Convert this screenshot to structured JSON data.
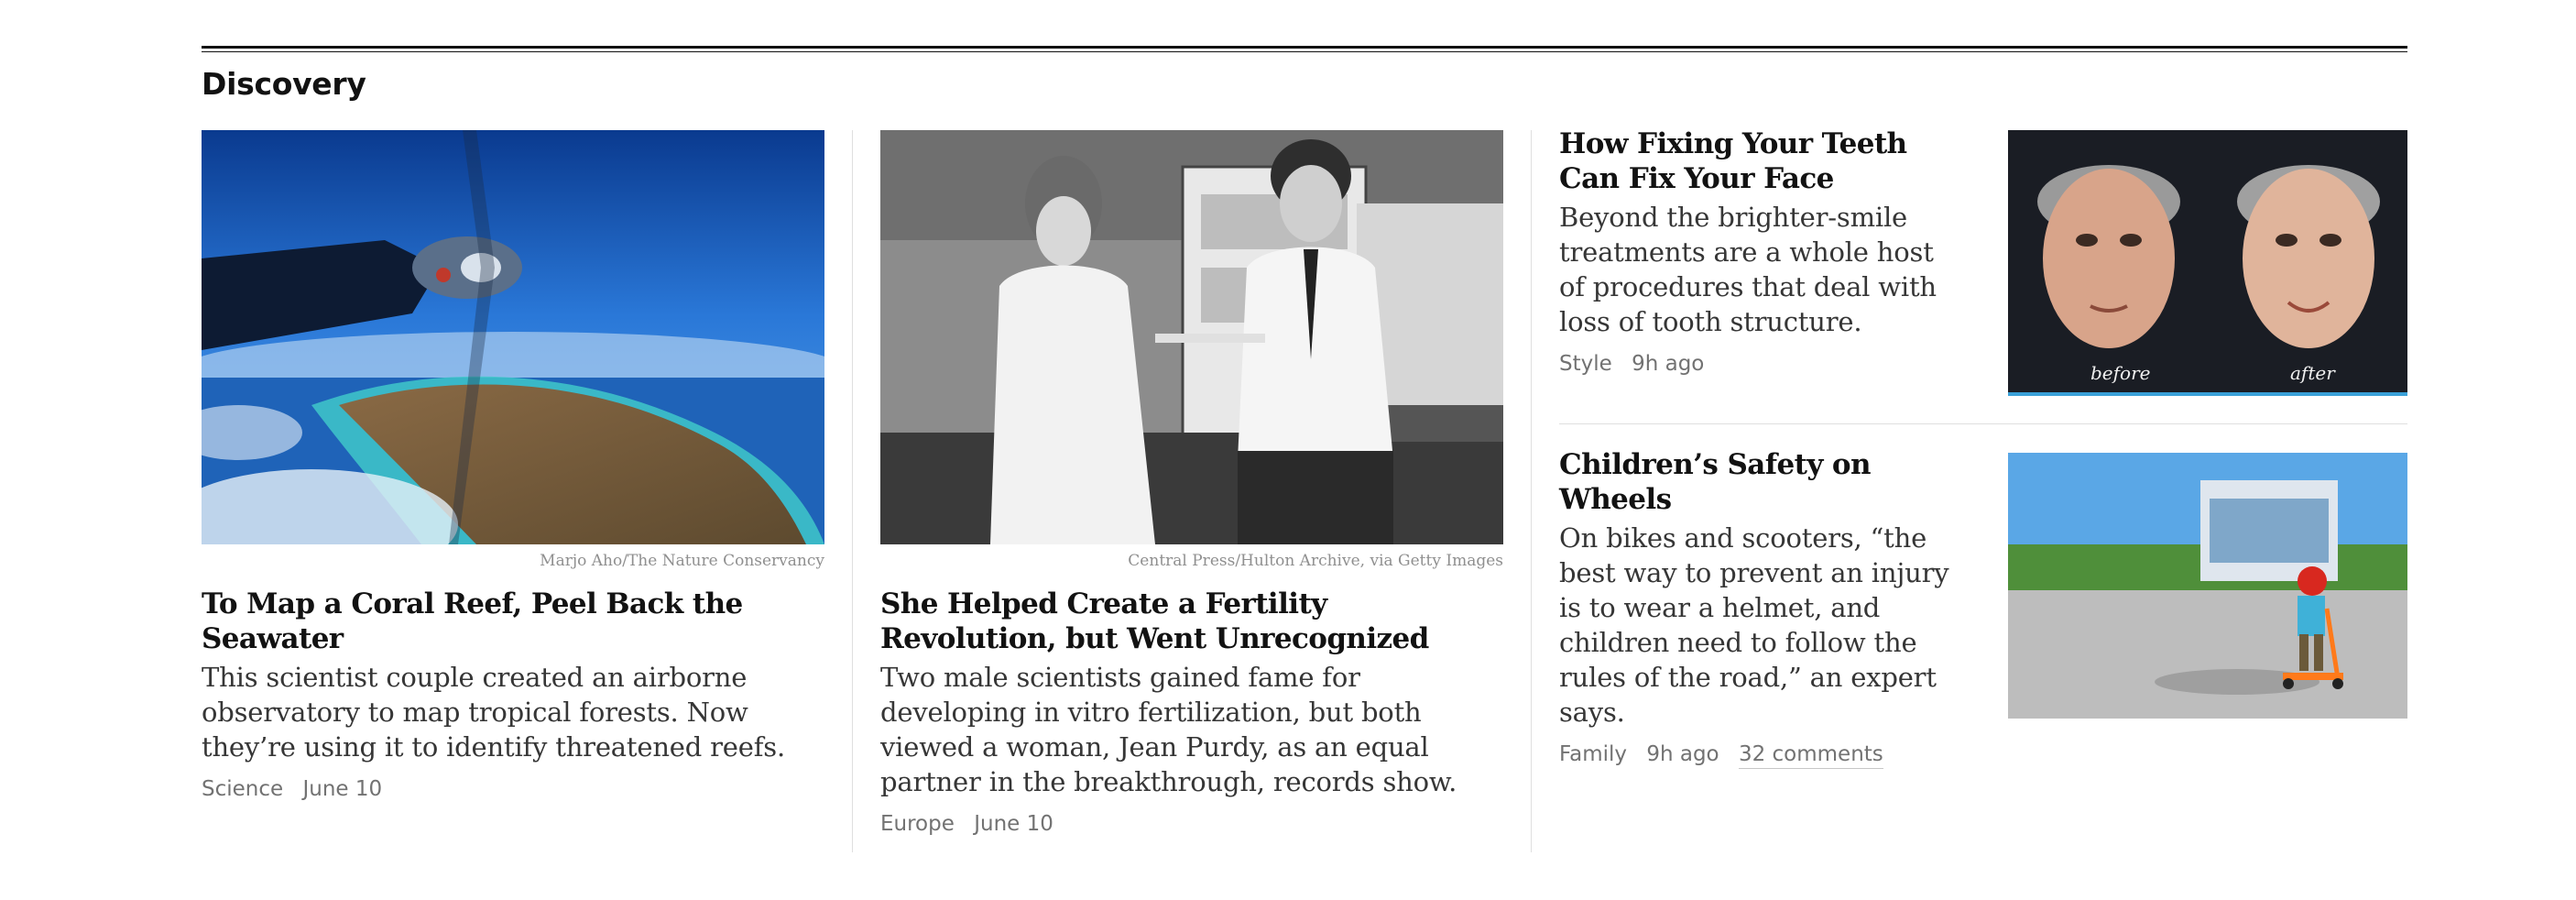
{
  "section": {
    "title": "Discovery"
  },
  "stories": [
    {
      "credit": "Marjo Aho/The Nature Conservancy",
      "headline": "To Map a Coral Reef, Peel Back the Seawater",
      "summary": "This scientist couple created an airborne observatory to map tropical forests. Now they’re using it to identify threatened reefs.",
      "section": "Science",
      "date": "June 10"
    },
    {
      "credit": "Central Press/Hulton Archive, via Getty Images",
      "headline": "She Helped Create a Fertility Revolution, but Went Unrecognized",
      "summary": "Two male scientists gained fame for developing in vitro fertilization, but both viewed a woman, Jean Purdy, as an equal partner in the breakthrough, records show.",
      "section": "Europe",
      "date": "June 10"
    },
    {
      "headline": "How Fixing Your Teeth Can Fix Your Face",
      "summary": "Beyond the brighter-smile treatments are a whole host of procedures that deal with loss of tooth structure.",
      "section": "Style",
      "date": "9h ago",
      "image_captions": [
        "before",
        "after"
      ]
    },
    {
      "headline": "Children’s Safety on Wheels",
      "summary": "On bikes and scooters, “the best way to prevent an injury is to wear a helmet, and children need to follow the rules of the road,” an expert says.",
      "section": "Family",
      "date": "9h ago",
      "comments": "32 comments"
    }
  ]
}
